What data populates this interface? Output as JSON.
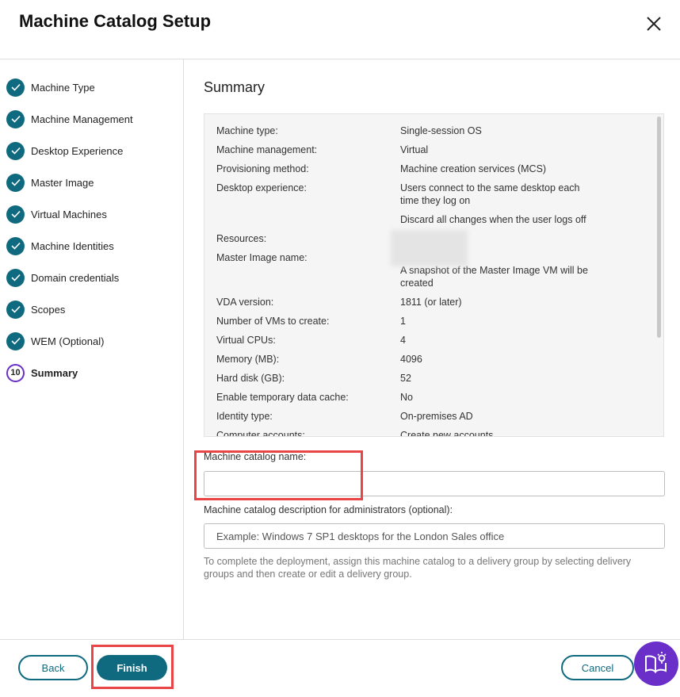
{
  "header": {
    "title": "Machine Catalog Setup",
    "close_icon": "close-icon"
  },
  "steps": [
    {
      "label": "Machine Type",
      "status": "done"
    },
    {
      "label": "Machine Management",
      "status": "done"
    },
    {
      "label": "Desktop Experience",
      "status": "done"
    },
    {
      "label": "Master Image",
      "status": "done"
    },
    {
      "label": "Virtual Machines",
      "status": "done"
    },
    {
      "label": "Machine Identities",
      "status": "done"
    },
    {
      "label": "Domain credentials",
      "status": "done"
    },
    {
      "label": "Scopes",
      "status": "done"
    },
    {
      "label": "WEM (Optional)",
      "status": "done"
    },
    {
      "label": "Summary",
      "status": "current",
      "number": "10"
    }
  ],
  "summary": {
    "title": "Summary",
    "rows": [
      {
        "label": "Machine type:",
        "values": [
          "Single-session OS"
        ]
      },
      {
        "label": "Machine management:",
        "values": [
          "Virtual"
        ]
      },
      {
        "label": "Provisioning method:",
        "values": [
          "Machine creation services (MCS)"
        ]
      },
      {
        "label": "Desktop experience:",
        "values": [
          "Users connect to the same desktop each time they log on",
          "Discard all changes when the user logs off"
        ]
      },
      {
        "label": "Resources:",
        "values": [
          ""
        ]
      },
      {
        "label": "Master Image name:",
        "values": [
          "",
          "A snapshot of the Master Image VM will be created"
        ]
      },
      {
        "label": "VDA version:",
        "values": [
          "1811 (or later)"
        ]
      },
      {
        "label": "Number of VMs to create:",
        "values": [
          "1"
        ]
      },
      {
        "label": "Virtual CPUs:",
        "values": [
          "4"
        ]
      },
      {
        "label": "Memory (MB):",
        "values": [
          "4096"
        ]
      },
      {
        "label": "Hard disk (GB):",
        "values": [
          "52"
        ]
      },
      {
        "label": "Enable temporary data cache:",
        "values": [
          "No"
        ]
      },
      {
        "label": "Identity type:",
        "values": [
          "On-premises AD"
        ]
      },
      {
        "label": "Computer accounts:",
        "values": [
          "Create new accounts"
        ]
      }
    ]
  },
  "form": {
    "name_label": "Machine catalog name:",
    "name_value": "",
    "desc_label": "Machine catalog description for administrators (optional):",
    "desc_placeholder": "Example: Windows 7 SP1 desktops for the London Sales office",
    "hint": "To complete the deployment, assign this machine catalog to a delivery group by selecting delivery groups and then create or edit a delivery group."
  },
  "footer": {
    "back": "Back",
    "finish": "Finish",
    "cancel": "Cancel",
    "help_icon": "book-lightbulb-icon"
  },
  "colors": {
    "accent": "#0f6a80",
    "current_step": "#6a2fc9",
    "highlight": "#e84646"
  }
}
